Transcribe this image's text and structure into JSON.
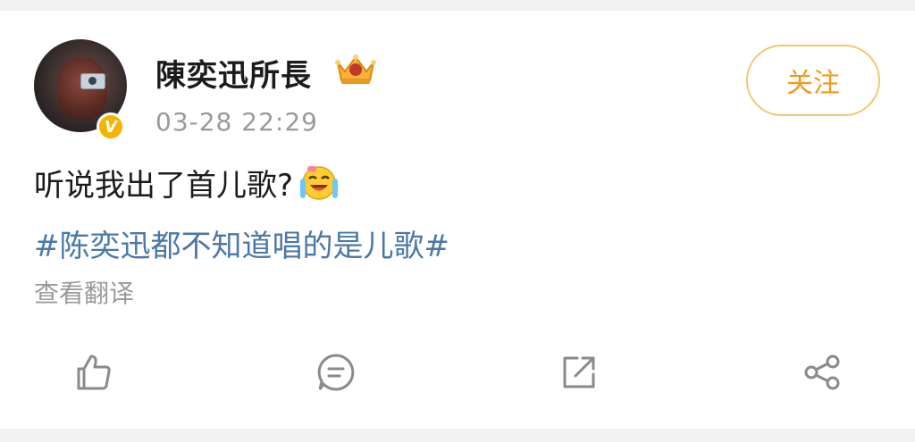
{
  "post": {
    "username": "陳奕迅所長",
    "timestamp": "03-28 22:29",
    "follow_label": "关注",
    "verified_badge": "V",
    "text": "听说我出了首儿歌?",
    "topic": "#陈奕迅都不知道唱的是儿歌#",
    "translate_label": "查看翻译"
  },
  "icons": {
    "crown": "crown-icon",
    "emoji": "laugh-cry-emoji",
    "like": "thumbs-up-icon",
    "comment": "comment-icon",
    "repost": "repost-icon",
    "share": "share-icon"
  },
  "colors": {
    "accent": "#f09a1a",
    "topic_link": "#4a78a8",
    "verified": "#f5b400",
    "muted": "#9a9a9a"
  }
}
